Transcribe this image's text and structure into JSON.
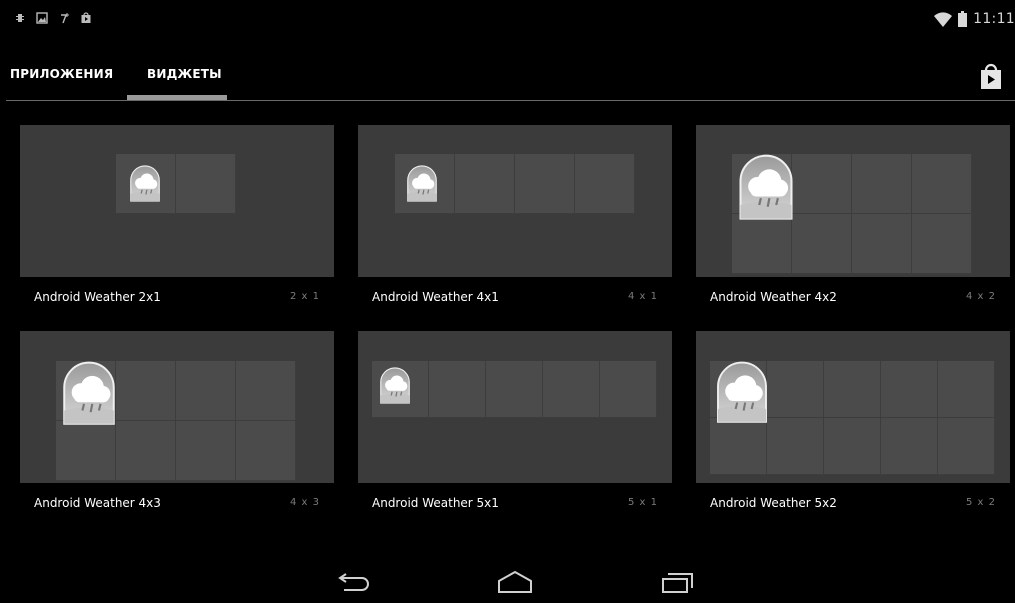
{
  "status_bar": {
    "time": "11:11",
    "icons": [
      "usb-debug-icon",
      "image-icon",
      "signal-icon",
      "play-store-notification-icon"
    ],
    "right_icons": [
      "wifi-icon",
      "battery-icon"
    ]
  },
  "tabs": {
    "apps_label": "ПРИЛОЖЕНИЯ",
    "widgets_label": "ВИДЖЕТЫ",
    "active": "ВИДЖЕТЫ"
  },
  "store_icon": "play-store-icon",
  "widgets": [
    {
      "label": "Android Weather 2x1",
      "size": "2 x 1"
    },
    {
      "label": "Android Weather 4x1",
      "size": "4 x 1"
    },
    {
      "label": "Android Weather 4x2",
      "size": "4 x 2"
    },
    {
      "label": "Android Weather 4x3",
      "size": "4 x 3"
    },
    {
      "label": "Android Weather 5x1",
      "size": "5 x 1"
    },
    {
      "label": "Android Weather 5x2",
      "size": "5 x 2"
    }
  ],
  "nav": {
    "back_icon": "back-icon",
    "home_icon": "home-icon",
    "recents_icon": "recents-icon"
  },
  "colors": {
    "background": "#000000",
    "card": "#3b3b3b",
    "cell": "#4b4b4b",
    "tab_indicator": "#9a9a9a"
  }
}
